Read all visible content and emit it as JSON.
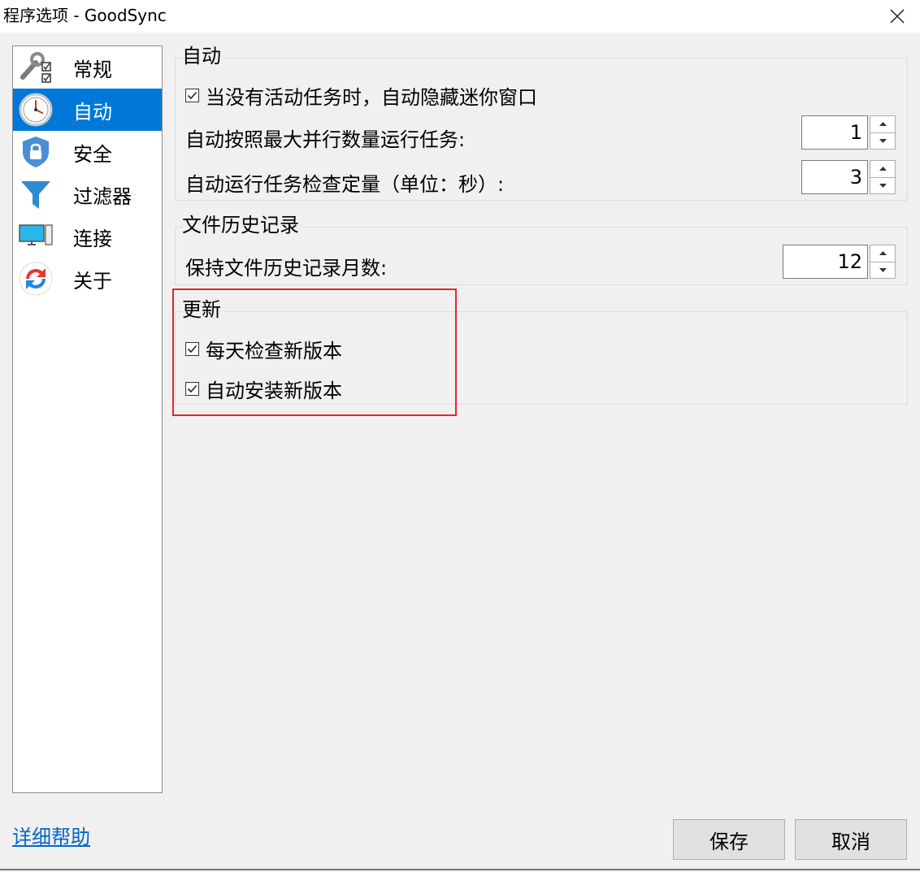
{
  "window": {
    "title": "程序选项 - GoodSync"
  },
  "sidebar": {
    "items": [
      {
        "label": "常规",
        "icon": "tools-checklist-icon",
        "selected": false
      },
      {
        "label": "自动",
        "icon": "clock-icon",
        "selected": true
      },
      {
        "label": "安全",
        "icon": "shield-lock-icon",
        "selected": false
      },
      {
        "label": "过滤器",
        "icon": "funnel-icon",
        "selected": false
      },
      {
        "label": "连接",
        "icon": "monitor-icon",
        "selected": false
      },
      {
        "label": "关于",
        "icon": "sync-logo-icon",
        "selected": false
      }
    ]
  },
  "auto": {
    "title": "自动",
    "hide_mini_window": {
      "label": "当没有活动任务时，自动隐藏迷你窗口",
      "checked": true
    },
    "max_parallel": {
      "label": "自动按照最大并行数量运行任务:",
      "value": "1"
    },
    "check_interval": {
      "label": "自动运行任务检查定量（单位：秒）:",
      "value": "3"
    }
  },
  "history": {
    "title": "文件历史记录",
    "months": {
      "label": "保持文件历史记录月数:",
      "value": "12"
    }
  },
  "update": {
    "title": "更新",
    "check_daily": {
      "label": "每天检查新版本",
      "checked": true
    },
    "auto_install": {
      "label": "自动安装新版本",
      "checked": true
    }
  },
  "footer": {
    "help": "详细帮助",
    "save": "保存",
    "cancel": "取消"
  },
  "colors": {
    "accent": "#0078d7",
    "highlight": "#e3262a",
    "link": "#0066cc"
  }
}
